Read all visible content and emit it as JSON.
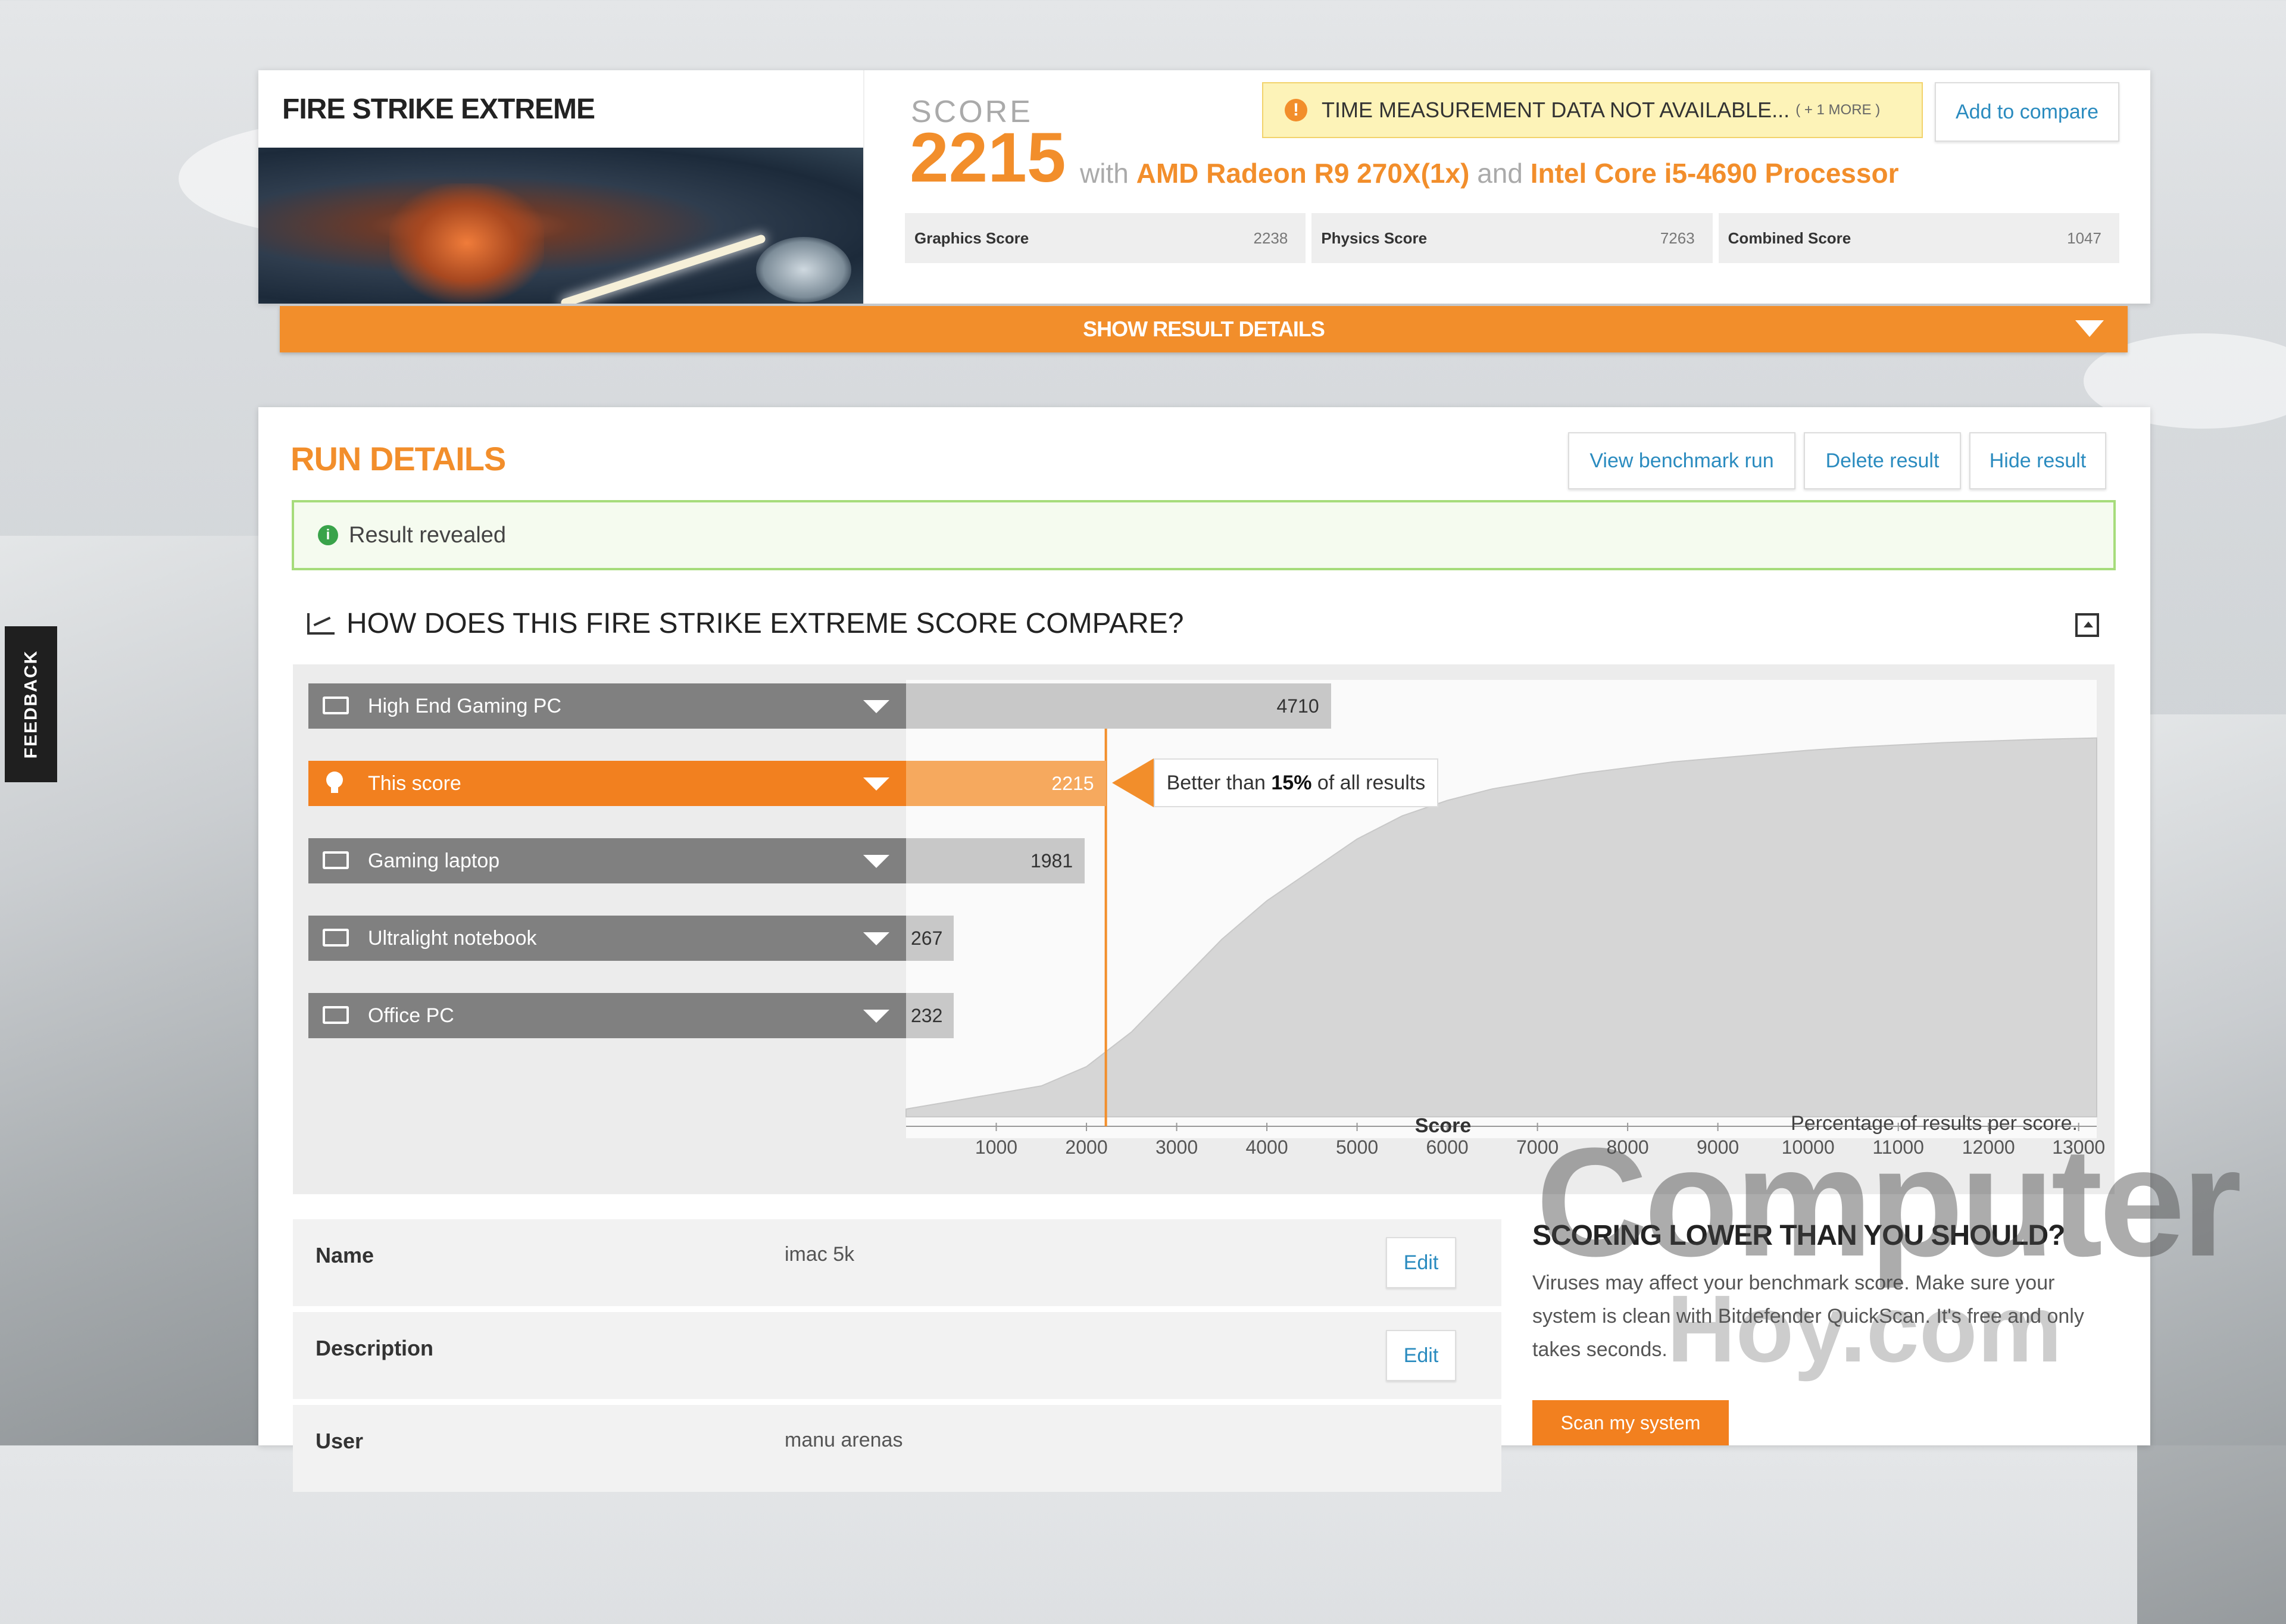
{
  "benchmark": {
    "title": "FIRE STRIKE EXTREME"
  },
  "score": {
    "label": "SCORE",
    "value": "2215",
    "with": "with",
    "gpu": "AMD Radeon R9 270X(1x)",
    "and": "and",
    "cpu": "Intel Core i5-4690 Processor"
  },
  "warning": {
    "text": "TIME MEASUREMENT DATA NOT AVAILABLE...",
    "more": "( + 1 MORE )",
    "icon": "!"
  },
  "compare_button": "Add to compare",
  "subscores": [
    {
      "label": "Graphics Score",
      "value": "2238"
    },
    {
      "label": "Physics Score",
      "value": "7263"
    },
    {
      "label": "Combined Score",
      "value": "1047"
    }
  ],
  "show_details": "SHOW RESULT DETAILS",
  "run": {
    "title": "RUN DETAILS",
    "buttons": [
      "View benchmark run",
      "Delete result",
      "Hide result"
    ],
    "revealed": "Result revealed",
    "revealed_icon": "i"
  },
  "compare": {
    "title": "HOW DOES THIS FIRE STRIKE EXTREME SCORE COMPARE?",
    "rows": [
      {
        "label": "High End Gaming PC",
        "value": 4710,
        "icon": "desktop-icon",
        "me": false
      },
      {
        "label": "This score",
        "value": 2215,
        "icon": "bulb-icon",
        "me": true
      },
      {
        "label": "Gaming laptop",
        "value": 1981,
        "icon": "laptop-icon",
        "me": false
      },
      {
        "label": "Ultralight notebook",
        "value": 267,
        "icon": "laptop-icon",
        "me": false
      },
      {
        "label": "Office PC",
        "value": 232,
        "icon": "desktop-icon",
        "me": false
      }
    ],
    "callout_prefix": "Better than",
    "callout_pct": "15%",
    "callout_suffix": "of all results"
  },
  "chart_data": {
    "type": "area",
    "xlabel": "Score",
    "note": "Percentage of results per score.",
    "xticks": [
      1000,
      2000,
      3000,
      4000,
      5000,
      6000,
      7000,
      8000,
      9000,
      10000,
      11000,
      12000,
      13000
    ],
    "xlim": [
      0,
      13200
    ],
    "marker": 2215,
    "x": [
      0,
      500,
      1000,
      1500,
      2000,
      2500,
      3000,
      3500,
      4000,
      4500,
      5000,
      5500,
      6000,
      6500,
      7000,
      7500,
      8000,
      8500,
      9000,
      9500,
      10000,
      10500,
      11000,
      11500,
      12000,
      12500,
      13200
    ],
    "y": [
      2,
      4,
      6,
      8,
      13,
      22,
      34,
      46,
      56,
      64,
      72,
      78,
      82,
      85,
      87,
      89,
      90.5,
      92,
      93,
      94,
      95,
      95.8,
      96.4,
      97,
      97.4,
      97.8,
      98.2
    ]
  },
  "info": [
    {
      "label": "Name",
      "value": "imac 5k",
      "edit": "Edit"
    },
    {
      "label": "Description",
      "value": "",
      "edit": "Edit"
    },
    {
      "label": "User",
      "value": "manu arenas",
      "edit": ""
    }
  ],
  "promo": {
    "title": "SCORING LOWER THAN YOU SHOULD?",
    "text": "Viruses may affect your benchmark score. Make sure your system is clean with Bitdefender QuickScan. It's free and only takes seconds.",
    "button": "Scan my system"
  },
  "feedback": "FEEDBACK",
  "watermark": {
    "line1": "Computer",
    "line2": "Hoy.com"
  }
}
